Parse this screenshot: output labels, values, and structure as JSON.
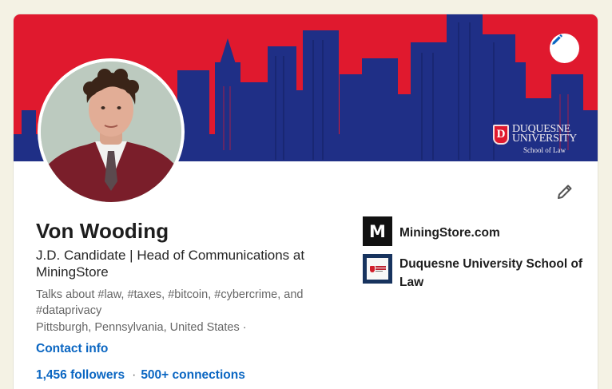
{
  "profile": {
    "name": "Von Wooding",
    "headline": "J.D. Candidate | Head of Communications at MiningStore",
    "talks_about": "Talks about #law, #taxes, #bitcoin, #cybercrime, and #dataprivacy",
    "location": "Pittsburgh, Pennsylvania, United States",
    "location_separator": "·",
    "contact_info": "Contact info",
    "followers": "1,456 followers",
    "stats_separator": "·",
    "connections": "500+ connections"
  },
  "banner": {
    "logo_mark": "D",
    "logo_line1": "DUQUESNE",
    "logo_line2": "UNIVERSITY",
    "logo_line3": "School of Law",
    "edit_icon": "pencil-icon",
    "colors": {
      "sky": "#e0192e",
      "buildings": "#1f2f86"
    }
  },
  "organizations": [
    {
      "name": "MiningStore.com",
      "logo_text": "M"
    },
    {
      "name": "Duquesne University School of Law"
    }
  ],
  "icons": {
    "profile_edit": "pencil-icon",
    "accent": "#0a66c2"
  }
}
